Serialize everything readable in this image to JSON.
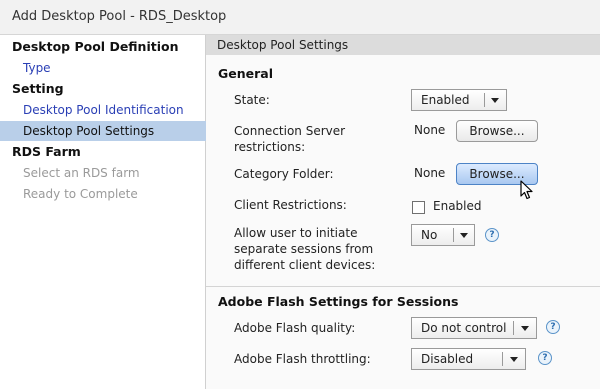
{
  "window": {
    "title": "Add Desktop Pool - RDS_Desktop"
  },
  "sidebar": {
    "items": [
      {
        "label": "Desktop Pool Definition",
        "kind": "heading"
      },
      {
        "label": "Type",
        "kind": "link"
      },
      {
        "label": "Setting",
        "kind": "heading"
      },
      {
        "label": "Desktop Pool Identification",
        "kind": "link"
      },
      {
        "label": "Desktop Pool Settings",
        "kind": "active"
      },
      {
        "label": "RDS Farm",
        "kind": "heading"
      },
      {
        "label": "Select an RDS farm",
        "kind": "disabled"
      },
      {
        "label": "Ready to Complete",
        "kind": "disabled"
      }
    ]
  },
  "main": {
    "header": "Desktop Pool Settings",
    "general": {
      "title": "General",
      "state_label": "State:",
      "state_value": "Enabled",
      "conn_server_label_1": "Connection Server",
      "conn_server_label_2": "restrictions:",
      "conn_server_value": "None",
      "conn_browse_label": "Browse...",
      "category_label": "Category Folder:",
      "category_value": "None",
      "category_browse_label": "Browse...",
      "client_restrictions_label": "Client Restrictions:",
      "client_restrictions_checkbox_label": "Enabled",
      "client_restrictions_checked": false,
      "separate_sessions_label_1": "Allow user to initiate",
      "separate_sessions_label_2": "separate sessions from",
      "separate_sessions_label_3": "different client devices:",
      "separate_sessions_value": "No"
    },
    "flash": {
      "title": "Adobe Flash Settings for Sessions",
      "quality_label": "Adobe Flash quality:",
      "quality_value": "Do not control",
      "throttling_label": "Adobe Flash throttling:",
      "throttling_value": "Disabled"
    },
    "help_glyph": "?"
  },
  "colors": {
    "nav_active_bg": "#b9cfe9",
    "link": "#2a3fb5",
    "header_bg": "#dcdcdc",
    "button_hover": "#a9c8f0"
  }
}
